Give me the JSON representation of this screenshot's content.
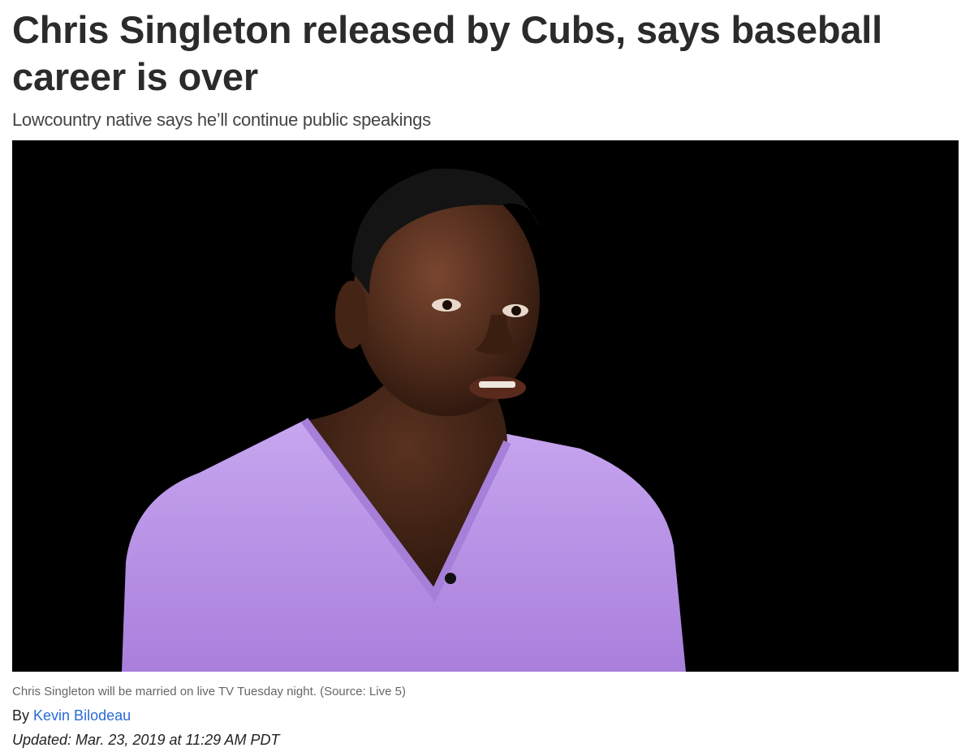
{
  "article": {
    "headline": "Chris Singleton released by Cubs, says baseball career is over",
    "subheadline": "Lowcountry native says he’ll continue public speakings",
    "photo": {
      "caption": "Chris Singleton will be married on live TV Tuesday night. (Source: Live 5)"
    },
    "byline": {
      "prefix": "By",
      "author": "Kevin Bilodeau"
    },
    "updated": "Updated: Mar. 23, 2019 at 11:29 AM PDT"
  },
  "colors": {
    "headline": "#2b2b2b",
    "author_link": "#2a6ad6",
    "caption": "#666666",
    "photo_background": "#000000",
    "shirt": "#b995e6"
  }
}
